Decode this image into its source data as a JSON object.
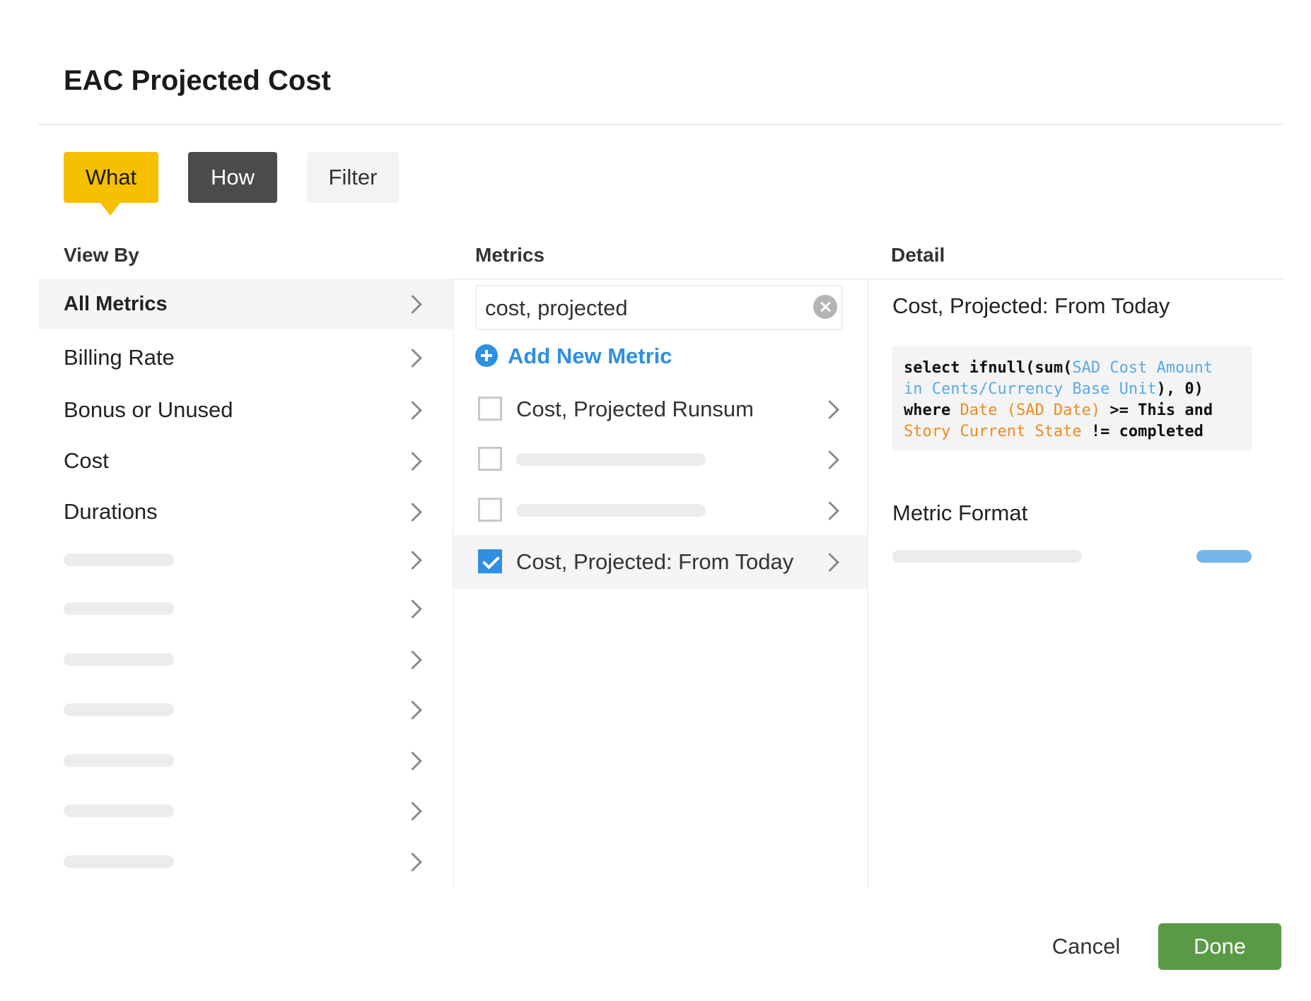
{
  "dialog": {
    "title": "EAC Projected Cost"
  },
  "tabs": [
    {
      "label": "What",
      "active": true
    },
    {
      "label": "How",
      "active": false
    },
    {
      "label": "Filter",
      "active": false
    }
  ],
  "columns": {
    "view_by": "View By",
    "metrics": "Metrics",
    "detail": "Detail"
  },
  "view_by": {
    "items": [
      {
        "label": "All Metrics",
        "active": true
      },
      {
        "label": "Billing Rate"
      },
      {
        "label": "Bonus or Unused"
      },
      {
        "label": "Cost"
      },
      {
        "label": "Durations"
      }
    ]
  },
  "metrics": {
    "search": {
      "value": "cost, projected"
    },
    "add_new_label": "Add New Metric",
    "items": [
      {
        "label": "Cost, Projected Runsum",
        "checked": false
      },
      {
        "label": "",
        "checked": false
      },
      {
        "label": "",
        "checked": false
      },
      {
        "label": "Cost, Projected: From Today",
        "checked": true
      }
    ]
  },
  "detail": {
    "title": "Cost, Projected: From Today",
    "query": {
      "t1": "select ifnull(sum(",
      "t2": "SAD Cost Amount in Cents/Currency Base Unit",
      "t3": "), 0) where ",
      "t4": "Date (SAD Date)",
      "t5": " >= This and ",
      "t6": "Story Current State",
      "t7": " != ",
      "t8": "completed"
    },
    "format_title": "Metric Format"
  },
  "footer": {
    "cancel_label": "Cancel",
    "done_label": "Done"
  },
  "colors": {
    "tab_active": "#f5c000",
    "tab_how": "#4b4b4b",
    "accent_blue": "#2f8fe0",
    "field_blue": "#5aa9e6",
    "field_orange": "#f08a1c",
    "done_green": "#5a9a47"
  }
}
